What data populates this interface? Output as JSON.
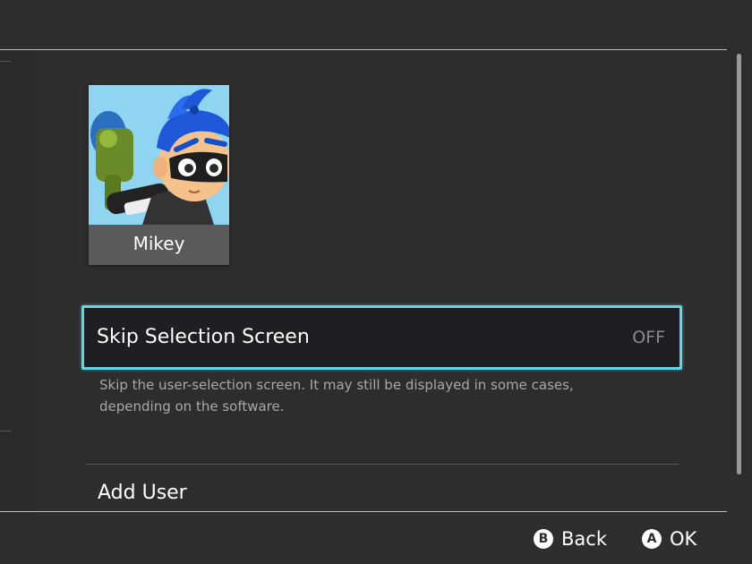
{
  "user": {
    "name": "Mikey",
    "avatar_icon": "inkling-boy-avatar-icon"
  },
  "skip_selection": {
    "label": "Skip Selection Screen",
    "value": "OFF",
    "description": "Skip the user-selection screen. It may still be displayed in some cases, depending on the software."
  },
  "add_user": {
    "label": "Add User"
  },
  "footer": {
    "back": {
      "glyph": "B",
      "label": "Back"
    },
    "ok": {
      "glyph": "A",
      "label": "OK"
    }
  },
  "colors": {
    "background": "#2d2d2d",
    "focus_border": "#60d6e6",
    "row_background": "#1f1f23",
    "avatar_background": "#8fd4f0"
  }
}
